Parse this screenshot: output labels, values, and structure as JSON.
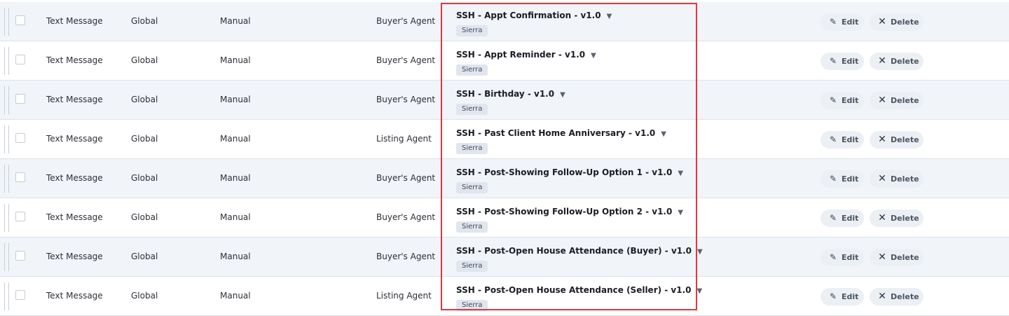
{
  "table": {
    "edit_label": "Edit",
    "delete_label": "Delete",
    "rows": [
      {
        "type": "Text Message",
        "scope": "Global",
        "trigger": "Manual",
        "role": "Buyer's Agent",
        "template": "SSH - Appt Confirmation - v1.0",
        "tag": "Sierra"
      },
      {
        "type": "Text Message",
        "scope": "Global",
        "trigger": "Manual",
        "role": "Buyer's Agent",
        "template": "SSH - Appt Reminder - v1.0",
        "tag": "Sierra"
      },
      {
        "type": "Text Message",
        "scope": "Global",
        "trigger": "Manual",
        "role": "Buyer's Agent",
        "template": "SSH - Birthday - v1.0",
        "tag": "Sierra"
      },
      {
        "type": "Text Message",
        "scope": "Global",
        "trigger": "Manual",
        "role": "Listing Agent",
        "template": "SSH - Past Client Home Anniversary - v1.0",
        "tag": "Sierra"
      },
      {
        "type": "Text Message",
        "scope": "Global",
        "trigger": "Manual",
        "role": "Buyer's Agent",
        "template": "SSH - Post-Showing Follow-Up Option 1 - v1.0",
        "tag": "Sierra"
      },
      {
        "type": "Text Message",
        "scope": "Global",
        "trigger": "Manual",
        "role": "Buyer's Agent",
        "template": "SSH - Post-Showing Follow-Up Option 2 - v1.0",
        "tag": "Sierra"
      },
      {
        "type": "Text Message",
        "scope": "Global",
        "trigger": "Manual",
        "role": "Buyer's Agent",
        "template": "SSH - Post-Open House Attendance (Buyer) - v1.0",
        "tag": "Sierra"
      },
      {
        "type": "Text Message",
        "scope": "Global",
        "trigger": "Manual",
        "role": "Listing Agent",
        "template": "SSH - Post-Open House Attendance (Seller) - v1.0",
        "tag": "Sierra"
      }
    ]
  },
  "colors": {
    "row_shaded": "#f1f4f9",
    "row_plain": "#ffffff",
    "highlight_border": "#e0373f",
    "tag_bg": "#e1e6ee",
    "button_bg": "#eceff4"
  },
  "icons": {
    "edit": "pencil-icon",
    "delete": "close-icon",
    "template_dropdown": "caret-down-icon",
    "row_handle": "drag-handle-icon"
  }
}
